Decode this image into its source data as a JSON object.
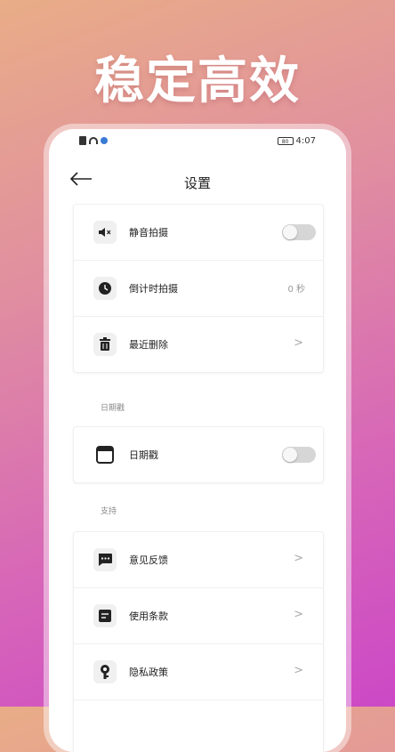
{
  "hero": {
    "title": "稳定高效"
  },
  "status_bar": {
    "battery": "80",
    "time": "4:07"
  },
  "header": {
    "title": "设置"
  },
  "card1": {
    "items": [
      {
        "label": "静音拍摄",
        "icon": "mute-speaker-icon",
        "control": "toggle",
        "on": false
      },
      {
        "label": "倒计时拍摄",
        "icon": "clock-icon",
        "control": "value",
        "value": "0 秒"
      },
      {
        "label": "最近删除",
        "icon": "trash-icon",
        "control": "chevron"
      }
    ]
  },
  "section_date": {
    "title": "日期戳"
  },
  "card2": {
    "items": [
      {
        "label": "日期戳",
        "icon": "calendar-icon",
        "control": "toggle",
        "on": false
      }
    ]
  },
  "section_support": {
    "title": "支持"
  },
  "card3": {
    "items": [
      {
        "label": "意见反馈",
        "icon": "chat-bubble-icon",
        "control": "chevron"
      },
      {
        "label": "使用条款",
        "icon": "document-icon",
        "control": "chevron"
      },
      {
        "label": "隐私政策",
        "icon": "keyhole-icon",
        "control": "chevron"
      }
    ]
  },
  "chevron_glyph": ">",
  "colors": {
    "accent_bg_top": "#e9ad87",
    "accent_bg_bottom": "#cc48c6",
    "toggle_off": "#d6d6d6"
  }
}
